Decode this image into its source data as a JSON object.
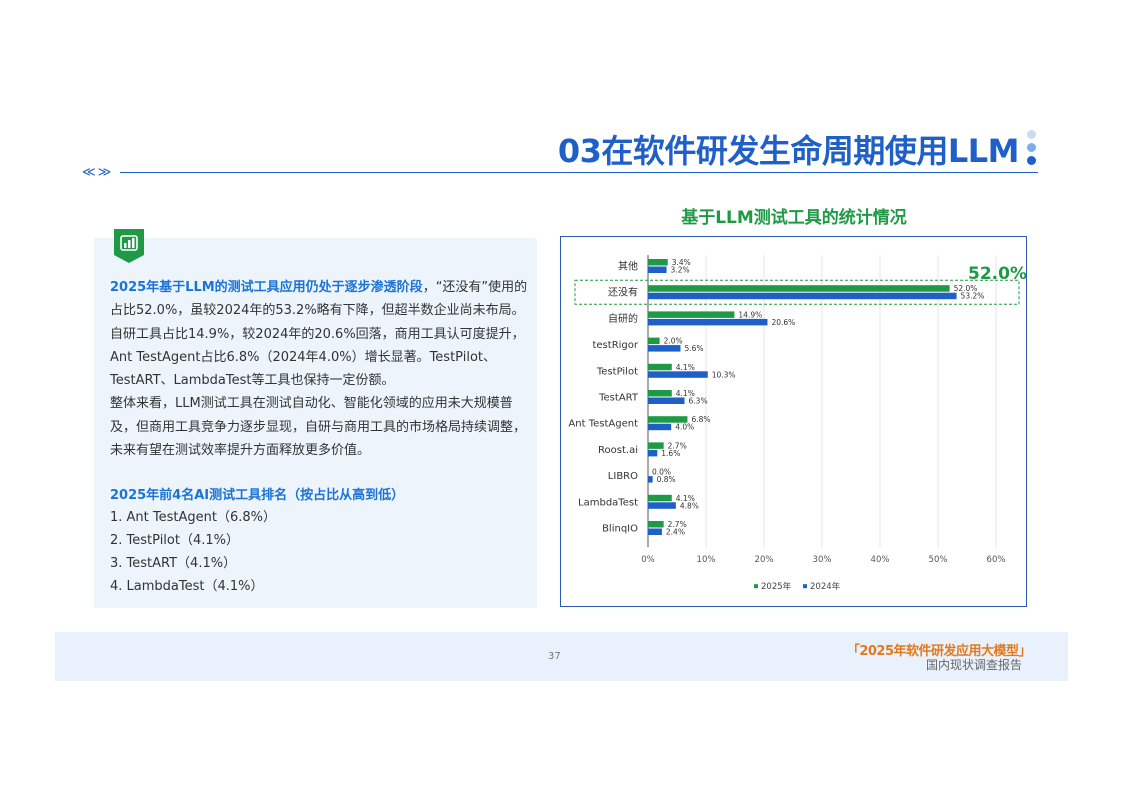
{
  "header": {
    "title": "03在软件研发生命周期使用LLM",
    "nav_arrows": "≪ ≫"
  },
  "left": {
    "para1_highlight": "2025年基于LLM的测试工具应用仍处于逐步渗透阶段",
    "para1_rest": "，“还没有”使用的占比52.0%，虽较2024年的53.2%略有下降，但超半数企业尚未布局。自研工具占比14.9%，较2024年的20.6%回落，商用工具认可度提升，Ant TestAgent占比6.8%（2024年4.0%）增长显著。TestPilot、TestART、LambdaTest等工具也保持一定份额。",
    "para2": "整体来看，LLM测试工具在测试自动化、智能化领域的应用未大规模普及，但商用工具竞争力逐步显现，自研与商用工具的市场格局持续调整，未来有望在测试效率提升方面释放更多价值。",
    "ranking_title": "2025年前4名AI测试工具排名（按占比从高到低）",
    "ranking": [
      "1. Ant TestAgent（6.8%）",
      "2. TestPilot（4.1%）",
      "3. TestART（4.1%）",
      "4. LambdaTest（4.1%）"
    ]
  },
  "chart_data": {
    "type": "bar",
    "orientation": "horizontal",
    "title": "基于LLM测试工具的统计情况",
    "categories": [
      "其他",
      "还没有",
      "自研的",
      "testRigor",
      "TestPilot",
      "TestART",
      "Ant TestAgent",
      "Roost.ai",
      "LIBRO",
      "LambdaTest",
      "BlinqIO"
    ],
    "series": [
      {
        "name": "2025年",
        "color": "#1e9a46",
        "values": [
          3.4,
          52.0,
          14.9,
          2.0,
          4.1,
          4.1,
          6.8,
          2.7,
          0.0,
          4.1,
          2.7
        ]
      },
      {
        "name": "2024年",
        "color": "#1f5fc8",
        "values": [
          3.2,
          53.2,
          20.6,
          5.6,
          10.3,
          6.3,
          4.0,
          1.6,
          0.8,
          4.8,
          2.4
        ]
      }
    ],
    "xlim": [
      0,
      60
    ],
    "xticks": [
      "0%",
      "10%",
      "20%",
      "30%",
      "40%",
      "50%",
      "60%"
    ],
    "grid": true,
    "legend": "bottom",
    "callout": "52.0%",
    "highlighted_category": "还没有"
  },
  "footer": {
    "page_number": "37",
    "brand": "「2025年软件研发应用大模型」",
    "subtitle": "国内现状调查报告"
  },
  "colors": {
    "brand_blue": "#1f5fc8",
    "accent_green": "#1e9a46",
    "panel_bg": "#edf4fc",
    "footer_orange": "#e07a1f"
  }
}
